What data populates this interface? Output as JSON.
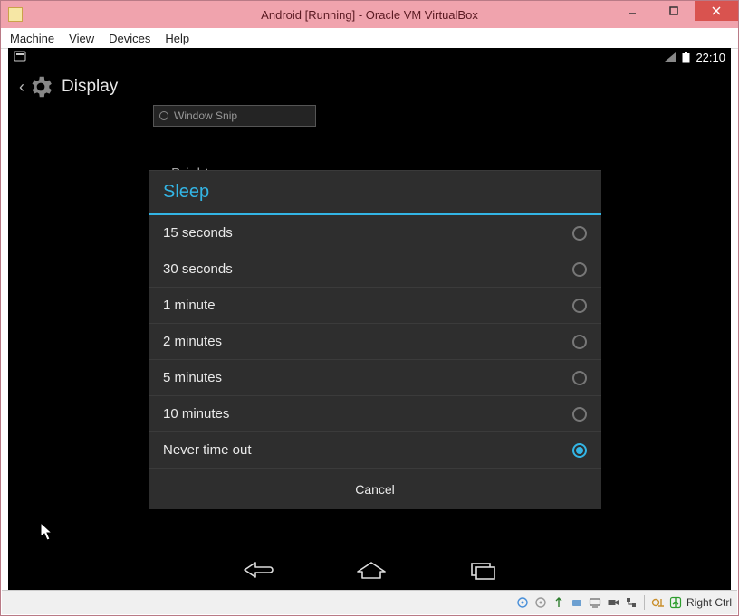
{
  "host": {
    "title": "Android [Running] - Oracle VM VirtualBox",
    "menu": {
      "machine": "Machine",
      "view": "View",
      "devices": "Devices",
      "help": "Help"
    },
    "hostkey_label": "Right Ctrl"
  },
  "android": {
    "clock": "22:10",
    "settings_title": "Display",
    "snip_label": "Window Snip",
    "bg_rows": {
      "brightness": "Brightness"
    }
  },
  "dialog": {
    "title": "Sleep",
    "options": [
      {
        "label": "15 seconds",
        "selected": false
      },
      {
        "label": "30 seconds",
        "selected": false
      },
      {
        "label": "1 minute",
        "selected": false
      },
      {
        "label": "2 minutes",
        "selected": false
      },
      {
        "label": "5 minutes",
        "selected": false
      },
      {
        "label": "10 minutes",
        "selected": false
      },
      {
        "label": "Never time out",
        "selected": true
      }
    ],
    "cancel": "Cancel"
  }
}
